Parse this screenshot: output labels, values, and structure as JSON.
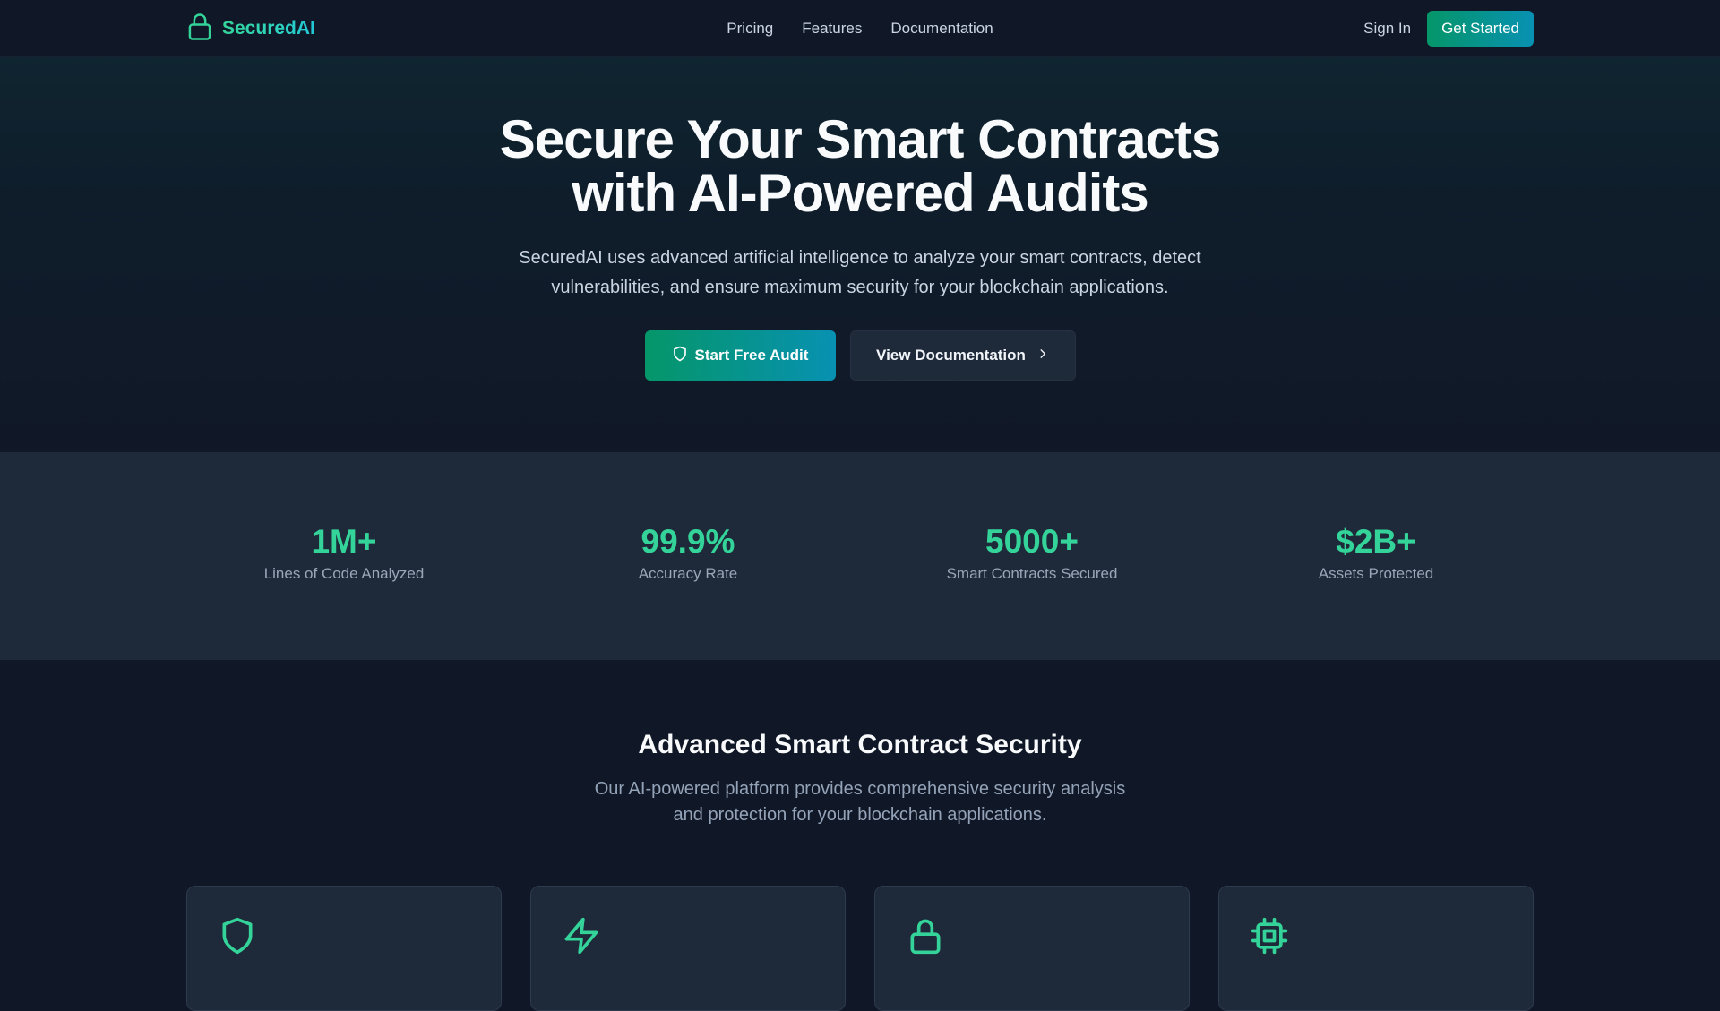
{
  "nav": {
    "brand": "SecuredAI",
    "links": [
      "Pricing",
      "Features",
      "Documentation"
    ],
    "sign_in": "Sign In",
    "get_started": "Get Started"
  },
  "hero": {
    "title_line1": "Secure Your Smart Contracts",
    "title_line2": "with AI-Powered Audits",
    "subtitle_line1": "SecuredAI uses advanced artificial intelligence to analyze your smart contracts, detect",
    "subtitle_line2": "vulnerabilities, and ensure maximum security for your blockchain applications.",
    "primary_cta": "Start Free Audit",
    "secondary_cta": "View Documentation"
  },
  "stats": [
    {
      "value": "1M+",
      "label": "Lines of Code Analyzed"
    },
    {
      "value": "99.9%",
      "label": "Accuracy Rate"
    },
    {
      "value": "5000+",
      "label": "Smart Contracts Secured"
    },
    {
      "value": "$2B+",
      "label": "Assets Protected"
    }
  ],
  "features": {
    "title": "Advanced Smart Contract Security",
    "subtitle_line1": "Our AI-powered platform provides comprehensive security analysis",
    "subtitle_line2": "and protection for your blockchain applications.",
    "card_icons": [
      "shield-icon",
      "lightning-icon",
      "lock-icon",
      "cpu-chip-icon"
    ]
  },
  "colors": {
    "accent": "#34d399",
    "background": "#101827",
    "surface": "#1e2939",
    "gradient_start": "#059669",
    "gradient_end": "#0891b2"
  }
}
